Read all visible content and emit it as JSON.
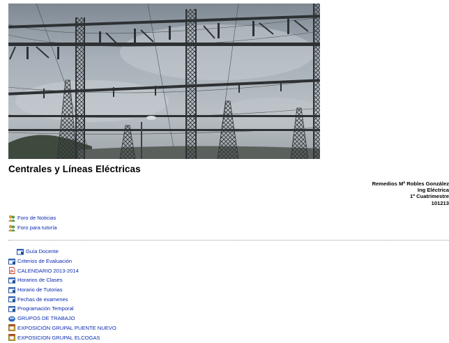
{
  "course": {
    "title": "Centrales y Líneas Eléctricas"
  },
  "teacher": {
    "name": "Remedios Mª Robles González",
    "degree": "Ing Eléctrica",
    "term": "1º Cuatrimestre",
    "code": "101213"
  },
  "forums": [
    {
      "label": "Foro de Noticias",
      "icon": "forum-icon"
    },
    {
      "label": "Foro para tutoría",
      "icon": "forum-icon"
    }
  ],
  "resources": [
    {
      "label": "Guía Docente",
      "icon": "document-icon",
      "indent": true
    },
    {
      "label": "Criterios de Evaluación",
      "icon": "document-icon"
    },
    {
      "label": "CALENDARIO 2013-2014",
      "icon": "pdf-icon"
    },
    {
      "label": "Horarios de Clases",
      "icon": "document-icon"
    },
    {
      "label": "Horario de Tutorias",
      "icon": "document-icon"
    },
    {
      "label": "Fechas de examenes",
      "icon": "document-icon"
    },
    {
      "label": "Programación Temporal",
      "icon": "document-icon"
    },
    {
      "label": "GRUPOS DE TRABAJO",
      "icon": "group-icon"
    },
    {
      "label": "EXPOSICIÓN GRUPAL PUENTE NUEVO",
      "icon": "assignment-icon"
    },
    {
      "label": "EXPOSICION GRUPAL ELCOGAS",
      "icon": "assignment-icon"
    }
  ],
  "colors": {
    "link": "#0a2bb0",
    "sky": "#8e99a3",
    "steel": "#2d3134",
    "hill": "#3f4a3e"
  }
}
